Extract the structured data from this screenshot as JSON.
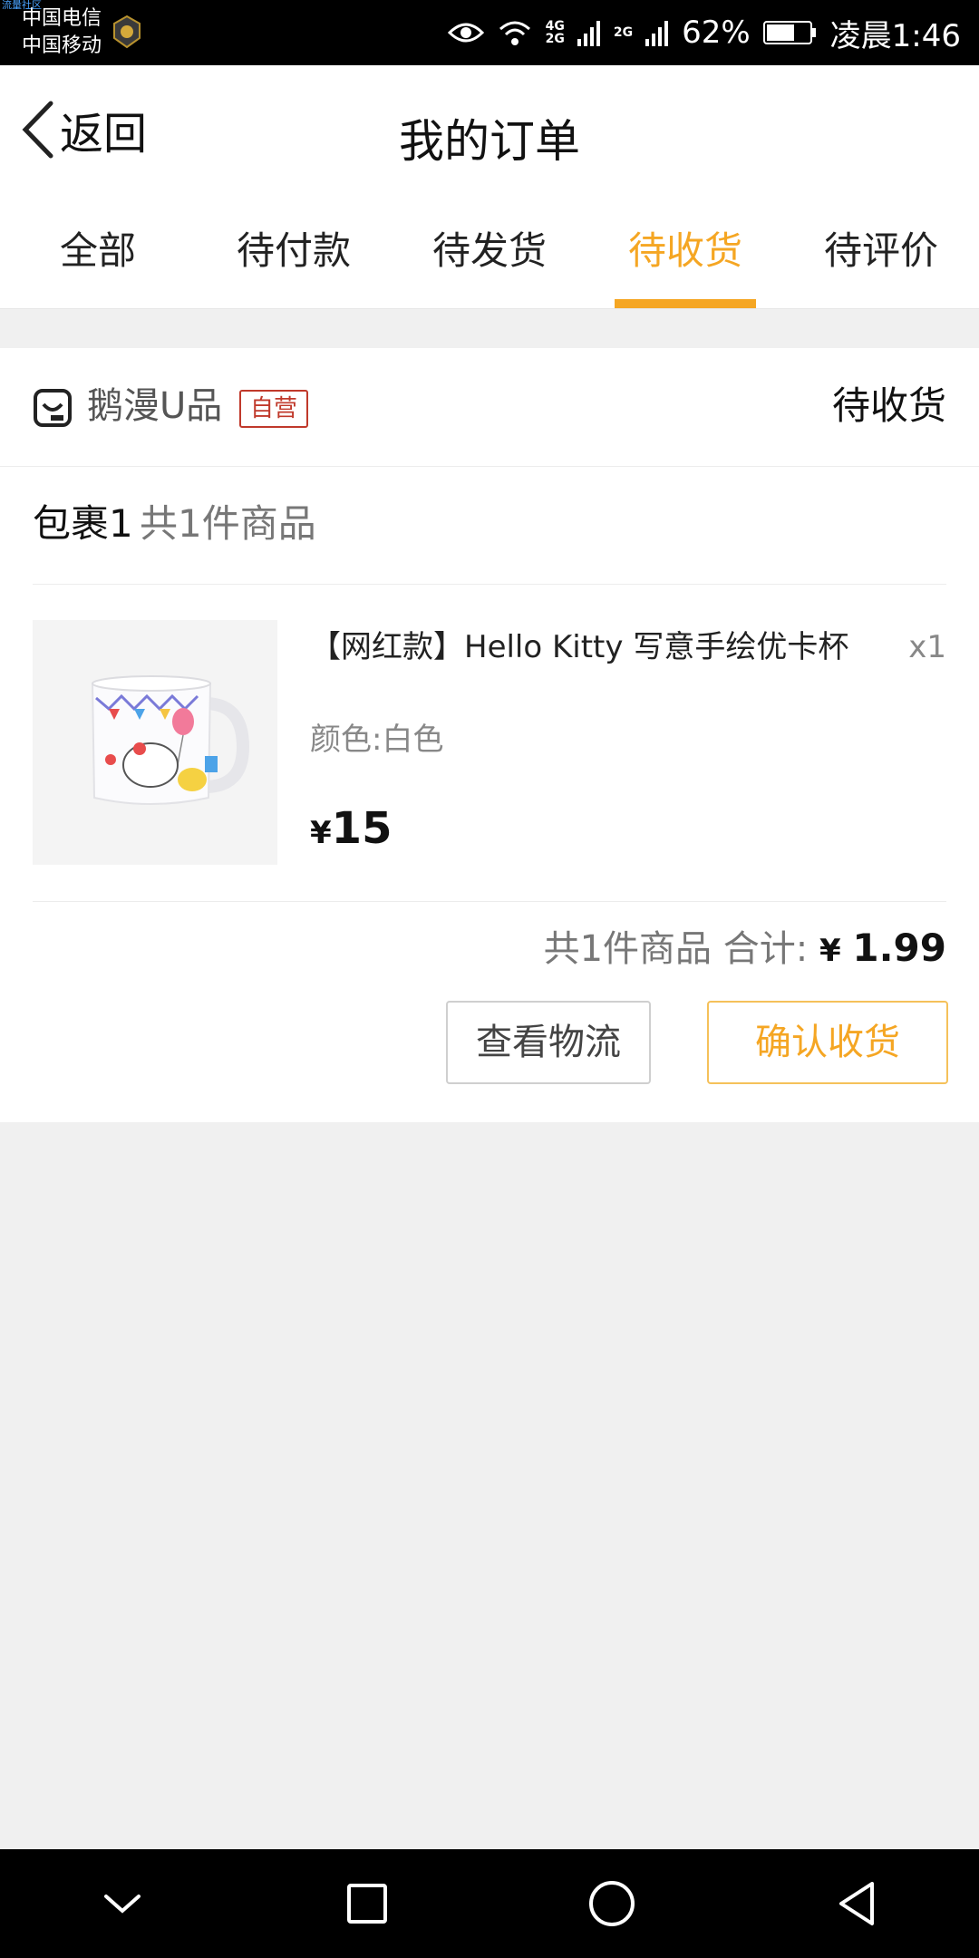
{
  "status_bar": {
    "watermark": "流量社区",
    "carrier_1": "中国电信",
    "carrier_2": "中国移动",
    "net_4g": "4G",
    "net_2g_a": "2G",
    "net_2g_b": "2G",
    "battery": "62%",
    "time": "凌晨1:46"
  },
  "header": {
    "back_label": "返回",
    "title": "我的订单"
  },
  "tabs": [
    {
      "label": "全部",
      "active": false
    },
    {
      "label": "待付款",
      "active": false
    },
    {
      "label": "待发货",
      "active": false
    },
    {
      "label": "待收货",
      "active": true
    },
    {
      "label": "待评价",
      "active": false
    }
  ],
  "order": {
    "shop_name": "鹅漫U品",
    "shop_tag": "自营",
    "status": "待收货",
    "parcel_label": "包裹1",
    "parcel_count": "共1件商品",
    "product": {
      "name": "【网红款】Hello Kitty 写意手绘优卡杯",
      "quantity": "x1",
      "spec": "颜色:白色",
      "price_symbol": "¥",
      "price": "15"
    },
    "summary_count": "共1件商品",
    "summary_label": "合计:",
    "total_symbol": "¥",
    "total": "1.99",
    "button_logistics": "查看物流",
    "button_confirm": "确认收货"
  },
  "colors": {
    "accent": "#f5a623",
    "tag_red": "#c0392b",
    "background": "#f0f0f0"
  }
}
